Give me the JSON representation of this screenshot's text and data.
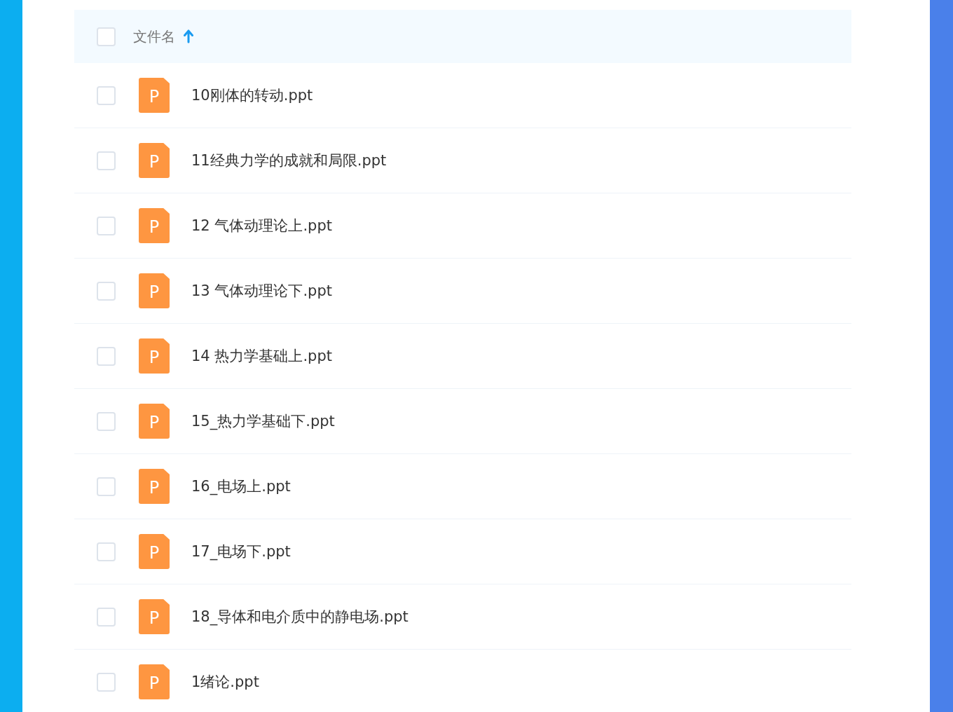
{
  "header": {
    "checked": false,
    "label": "文件名",
    "sort_ascending": true
  },
  "files": [
    {
      "checked": false,
      "icon_label": "P",
      "name": "10刚体的转动.ppt"
    },
    {
      "checked": false,
      "icon_label": "P",
      "name": "11经典力学的成就和局限.ppt"
    },
    {
      "checked": false,
      "icon_label": "P",
      "name": "12 气体动理论上.ppt"
    },
    {
      "checked": false,
      "icon_label": "P",
      "name": "13 气体动理论下.ppt"
    },
    {
      "checked": false,
      "icon_label": "P",
      "name": "14 热力学基础上.ppt"
    },
    {
      "checked": false,
      "icon_label": "P",
      "name": "15_热力学基础下.ppt"
    },
    {
      "checked": false,
      "icon_label": "P",
      "name": "16_电场上.ppt"
    },
    {
      "checked": false,
      "icon_label": "P",
      "name": "17_电场下.ppt"
    },
    {
      "checked": false,
      "icon_label": "P",
      "name": "18_导体和电介质中的静电场.ppt"
    },
    {
      "checked": false,
      "icon_label": "P",
      "name": "1绪论.ppt"
    }
  ]
}
